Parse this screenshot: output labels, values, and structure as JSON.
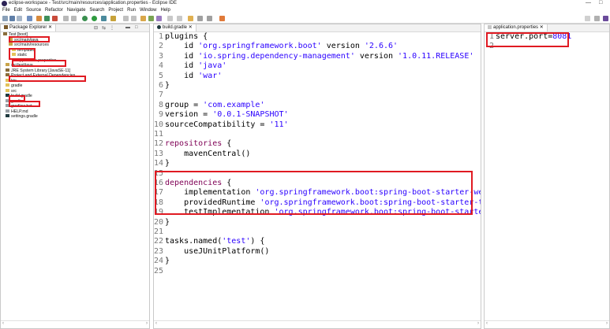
{
  "window": {
    "title": "eclipse-workspace - Test/src/main/resources/application.properties - Eclipse IDE",
    "minimize_glyph": "—",
    "maximize_glyph": "□"
  },
  "menu": [
    "File",
    "Edit",
    "Source",
    "Refactor",
    "Navigate",
    "Search",
    "Project",
    "Run",
    "Window",
    "Help"
  ],
  "package_explorer": {
    "tab_label": "Package Explorer ✕",
    "items": [
      {
        "label": "Test [boot]",
        "icon": "project-icon"
      },
      {
        "label": "src/main/java",
        "icon": "source-folder-icon"
      },
      {
        "label": "src/main/resources",
        "icon": "source-folder-icon"
      },
      {
        "label": "templates",
        "icon": "folder-icon"
      },
      {
        "label": "static",
        "icon": "folder-icon"
      },
      {
        "label": "application.properties",
        "icon": "properties-file-icon"
      },
      {
        "label": "src/test/java",
        "icon": "source-folder-icon"
      },
      {
        "label": "JRE System Library [JavaSE-11]",
        "icon": "library-icon"
      },
      {
        "label": "Project and External Dependencies",
        "icon": "library-icon"
      },
      {
        "label": "bin",
        "icon": "folder-icon"
      },
      {
        "label": "gradle",
        "icon": "folder-icon"
      },
      {
        "label": "src",
        "icon": "folder-icon"
      },
      {
        "label": "build.gradle",
        "icon": "gradle-file-icon"
      },
      {
        "label": "gradlew",
        "icon": "file-icon"
      },
      {
        "label": "gradlew.bat",
        "icon": "file-icon"
      },
      {
        "label": "HELP.md",
        "icon": "file-icon"
      },
      {
        "label": "settings.gradle",
        "icon": "gradle-file-icon"
      }
    ]
  },
  "build_gradle_editor": {
    "tab_label": "build.gradle ✕",
    "lines": [
      {
        "n": "1",
        "parts": [
          {
            "t": "plugins {",
            "c": ""
          }
        ]
      },
      {
        "n": "2",
        "parts": [
          {
            "t": "    id ",
            "c": ""
          },
          {
            "t": "'org.springframework.boot'",
            "c": "str"
          },
          {
            "t": " version ",
            "c": ""
          },
          {
            "t": "'2.6.6'",
            "c": "str"
          }
        ]
      },
      {
        "n": "3",
        "parts": [
          {
            "t": "    id ",
            "c": ""
          },
          {
            "t": "'io.spring.dependency-management'",
            "c": "str"
          },
          {
            "t": " version ",
            "c": ""
          },
          {
            "t": "'1.0.11.RELEASE'",
            "c": "str"
          }
        ]
      },
      {
        "n": "4",
        "parts": [
          {
            "t": "    id ",
            "c": ""
          },
          {
            "t": "'java'",
            "c": "str"
          }
        ]
      },
      {
        "n": "5",
        "parts": [
          {
            "t": "    id ",
            "c": ""
          },
          {
            "t": "'war'",
            "c": "str"
          }
        ]
      },
      {
        "n": "6",
        "parts": [
          {
            "t": "}",
            "c": ""
          }
        ]
      },
      {
        "n": "7",
        "parts": [
          {
            "t": "",
            "c": ""
          }
        ]
      },
      {
        "n": "8",
        "parts": [
          {
            "t": "group = ",
            "c": ""
          },
          {
            "t": "'com.example'",
            "c": "str"
          }
        ]
      },
      {
        "n": "9",
        "parts": [
          {
            "t": "version = ",
            "c": ""
          },
          {
            "t": "'0.0.1-SNAPSHOT'",
            "c": "str"
          }
        ]
      },
      {
        "n": "10",
        "parts": [
          {
            "t": "sourceCompatibility = ",
            "c": ""
          },
          {
            "t": "'11'",
            "c": "str"
          }
        ]
      },
      {
        "n": "11",
        "parts": [
          {
            "t": "",
            "c": ""
          }
        ]
      },
      {
        "n": "12",
        "parts": [
          {
            "t": "repositories",
            "c": "kw"
          },
          {
            "t": " {",
            "c": ""
          }
        ]
      },
      {
        "n": "13",
        "parts": [
          {
            "t": "    mavenCentral()",
            "c": ""
          }
        ]
      },
      {
        "n": "14",
        "parts": [
          {
            "t": "}",
            "c": ""
          }
        ]
      },
      {
        "n": "15",
        "parts": [
          {
            "t": "",
            "c": ""
          }
        ]
      },
      {
        "n": "16",
        "parts": [
          {
            "t": "dependencies",
            "c": "kw"
          },
          {
            "t": " {",
            "c": ""
          }
        ]
      },
      {
        "n": "17",
        "parts": [
          {
            "t": "    implementation ",
            "c": ""
          },
          {
            "t": "'org.springframework.boot:spring-boot-starter-web'",
            "c": "str"
          }
        ]
      },
      {
        "n": "18",
        "parts": [
          {
            "t": "    providedRuntime ",
            "c": ""
          },
          {
            "t": "'org.springframework.boot:spring-boot-starter-tomcat'",
            "c": "str"
          }
        ]
      },
      {
        "n": "19",
        "parts": [
          {
            "t": "    testImplementation ",
            "c": ""
          },
          {
            "t": "'org.springframework.boot:spring-boot-starter-test'",
            "c": "str"
          }
        ]
      },
      {
        "n": "20",
        "parts": [
          {
            "t": "}",
            "c": ""
          }
        ]
      },
      {
        "n": "21",
        "parts": [
          {
            "t": "",
            "c": ""
          }
        ]
      },
      {
        "n": "22",
        "parts": [
          {
            "t": "tasks.named(",
            "c": ""
          },
          {
            "t": "'test'",
            "c": "str"
          },
          {
            "t": ") {",
            "c": ""
          }
        ]
      },
      {
        "n": "23",
        "parts": [
          {
            "t": "    useJUnitPlatform()",
            "c": ""
          }
        ]
      },
      {
        "n": "24",
        "parts": [
          {
            "t": "}",
            "c": ""
          }
        ]
      },
      {
        "n": "25",
        "parts": [
          {
            "t": "",
            "c": ""
          }
        ]
      }
    ]
  },
  "properties_editor": {
    "tab_label": "application.properties ✕",
    "lines": [
      {
        "n": "1",
        "parts": [
          {
            "t": "server.port=",
            "c": ""
          },
          {
            "t": "8081",
            "c": "str"
          }
        ]
      },
      {
        "n": "2",
        "parts": [
          {
            "t": "",
            "c": ""
          }
        ]
      }
    ]
  },
  "colors": {
    "highlight": "#e01a22",
    "string": "#2a00ff",
    "keyword": "#7f0055"
  }
}
